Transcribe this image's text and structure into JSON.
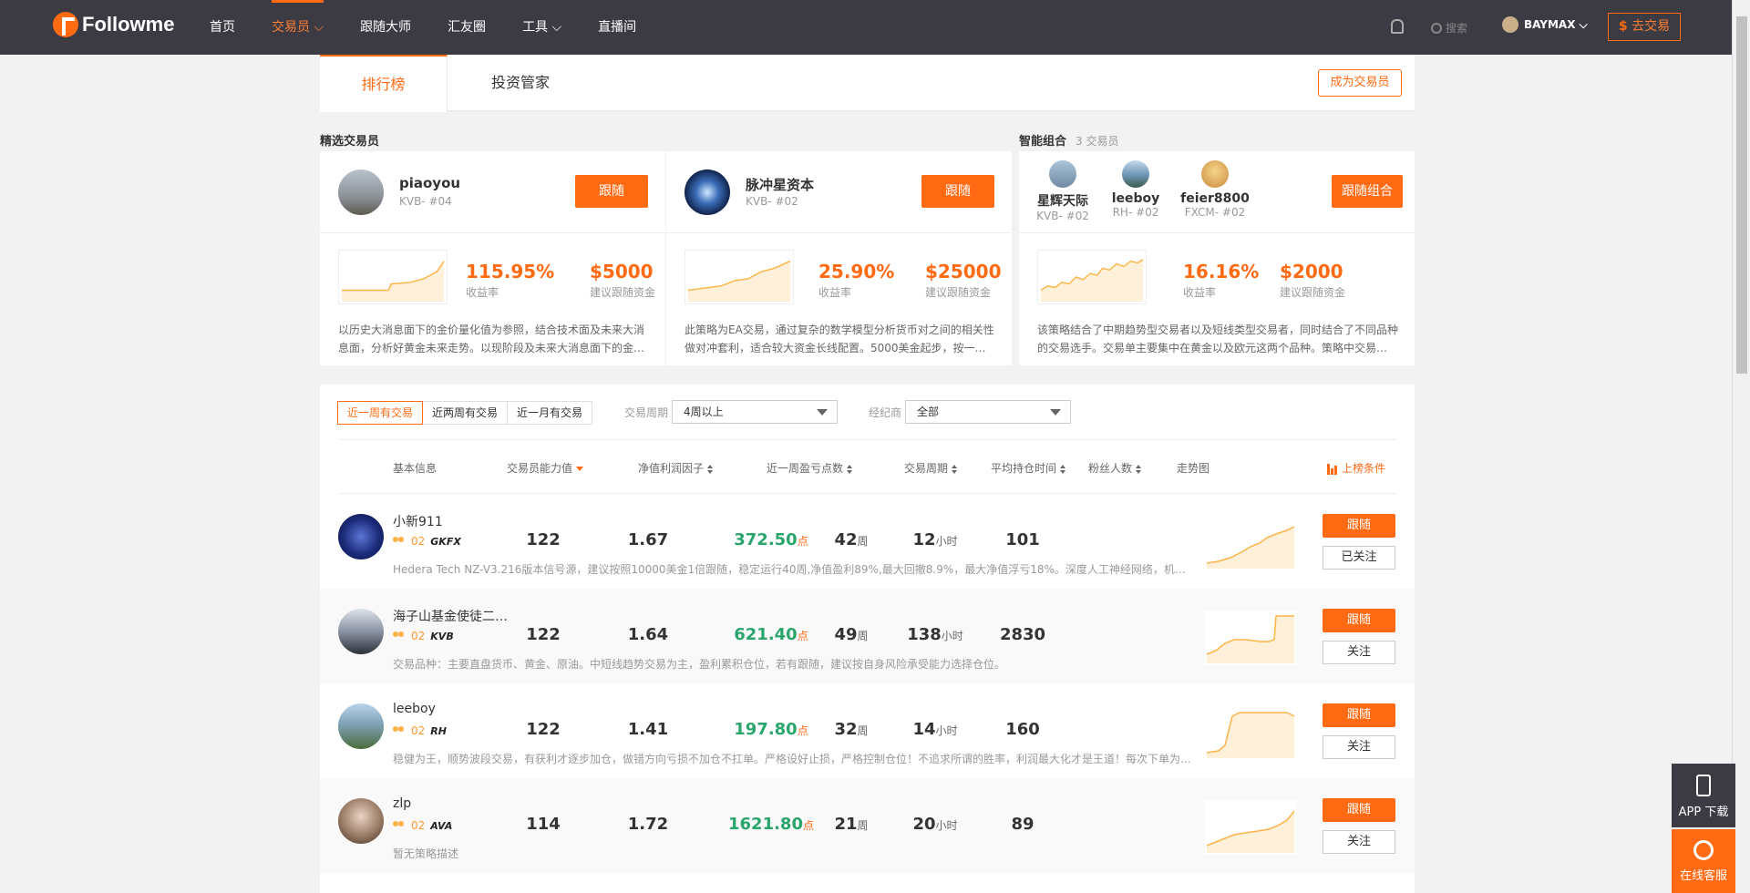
{
  "nav": {
    "logo_text": "Followme",
    "items": [
      {
        "label": "首页"
      },
      {
        "label": "交易员 ⌵"
      },
      {
        "label": "跟随大师"
      },
      {
        "label": "汇友圈"
      },
      {
        "label": "工具 ⌵"
      },
      {
        "label": "直播间"
      }
    ],
    "search_placeholder": "搜索",
    "username": "BAYMAX ⌵",
    "trade_btn_symbol": "$",
    "trade_btn": "去交易"
  },
  "tabs": {
    "ranking": "排行榜",
    "manager": "投资管家",
    "become_trader": "成为交易员"
  },
  "featured": {
    "title": "精选交易员",
    "cards": [
      {
        "name": "piaoyou",
        "rank": "KVB- #04",
        "follow": "跟随",
        "return": "115.95%",
        "return_label": "收益率",
        "capital": "$5000",
        "capital_label": "建议跟随资金",
        "desc": "以历史大消息面下的金价量化值为参照，结合技术面及未来大消息面，分析好黄金未来走势。以现阶段及未来大消息面下的金…"
      },
      {
        "name": "脉冲星资本",
        "rank": "KVB- #02",
        "follow": "跟随",
        "return": "25.90%",
        "return_label": "收益率",
        "capital": "$25000",
        "capital_label": "建议跟随资金",
        "desc": "此策略为EA交易，通过复杂的数学模型分析货币对之间的相关性做对冲套利，适合较大资金长线配置。5000美金起步，按一…"
      }
    ]
  },
  "combo": {
    "title": "智能组合",
    "count": "3 交易员",
    "members": [
      {
        "name": "星辉天际",
        "rank": "KVB- #02"
      },
      {
        "name": "leeboy",
        "rank": "RH- #02"
      },
      {
        "name": "feier8800",
        "rank": "FXCM- #02"
      }
    ],
    "follow": "跟随组合",
    "return": "16.16%",
    "return_label": "收益率",
    "capital": "$2000",
    "capital_label": "建议跟随资金",
    "desc": "该策略结合了中期趋势型交易者以及短线类型交易者，同时结合了不同品种的交易选手。交易单主要集中在黄金以及欧元这两个品种。策略中交易…"
  },
  "filters": {
    "segments": [
      "近一周有交易",
      "近两周有交易",
      "近一月有交易"
    ],
    "period_label": "交易周期",
    "period_value": "4周以上",
    "broker_label": "经纪商",
    "broker_value": "全部"
  },
  "table": {
    "headers": {
      "basic": "基本信息",
      "ability": "交易员能力值",
      "factor": "净值利润因子",
      "pips": "近一周盈亏点数",
      "period": "交易周期",
      "hold": "平均持仓时间",
      "fans": "粉丝人数",
      "trend": "走势图",
      "condition": "上榜条件"
    },
    "rows": [
      {
        "name": "小新911",
        "badge": "02",
        "broker": "GKFX",
        "desc": "Hedera Tech NZ-V3.216版本信号源，建议按照10000美金1倍跟随，稳定运行40周,净值盈利89%,最大回撤8.9%，最大净值浮亏18%。深度人工神经网络，机构开…",
        "ability": "122",
        "factor": "1.67",
        "pips": "372.50",
        "pips_unit": "点",
        "period": "42",
        "period_unit": "周",
        "hold": "12",
        "hold_unit": "小时",
        "fans": "101",
        "follow": "跟随",
        "watch": "已关注"
      },
      {
        "name": "海子山基金使徒二…",
        "badge": "02",
        "broker": "KVB",
        "desc": "交易品种：主要直盘货币、黄金、原油。中短线趋势交易为主，盈利累积仓位，若有跟随，建议按自身风险承受能力选择仓位。",
        "ability": "122",
        "factor": "1.64",
        "pips": "621.40",
        "pips_unit": "点",
        "period": "49",
        "period_unit": "周",
        "hold": "138",
        "hold_unit": "小时",
        "fans": "2830",
        "follow": "跟随",
        "watch": "关注"
      },
      {
        "name": "leeboy",
        "badge": "02",
        "broker": "RH",
        "desc": "稳健为王，顺势波段交易，有获利才逐步加仓，做错方向亏损不加仓不扛单。严格设好止损，严格控制仓位！不追求所谓的胜率，利润最大化才是王道！每次下单为1…",
        "ability": "122",
        "factor": "1.41",
        "pips": "197.80",
        "pips_unit": "点",
        "period": "32",
        "period_unit": "周",
        "hold": "14",
        "hold_unit": "小时",
        "fans": "160",
        "follow": "跟随",
        "watch": "关注"
      },
      {
        "name": "zlp",
        "badge": "02",
        "broker": "AVA",
        "desc": "暂无策略描述",
        "ability": "114",
        "factor": "1.72",
        "pips": "1621.80",
        "pips_unit": "点",
        "period": "21",
        "period_unit": "周",
        "hold": "20",
        "hold_unit": "小时",
        "fans": "89",
        "follow": "跟随",
        "watch": "关注"
      }
    ]
  },
  "side": {
    "app": "APP 下载",
    "cs": "在线客服"
  },
  "colors": {
    "accent": "#ff6a13",
    "nav_bg": "#3c3b44",
    "green": "#2aa66c"
  }
}
